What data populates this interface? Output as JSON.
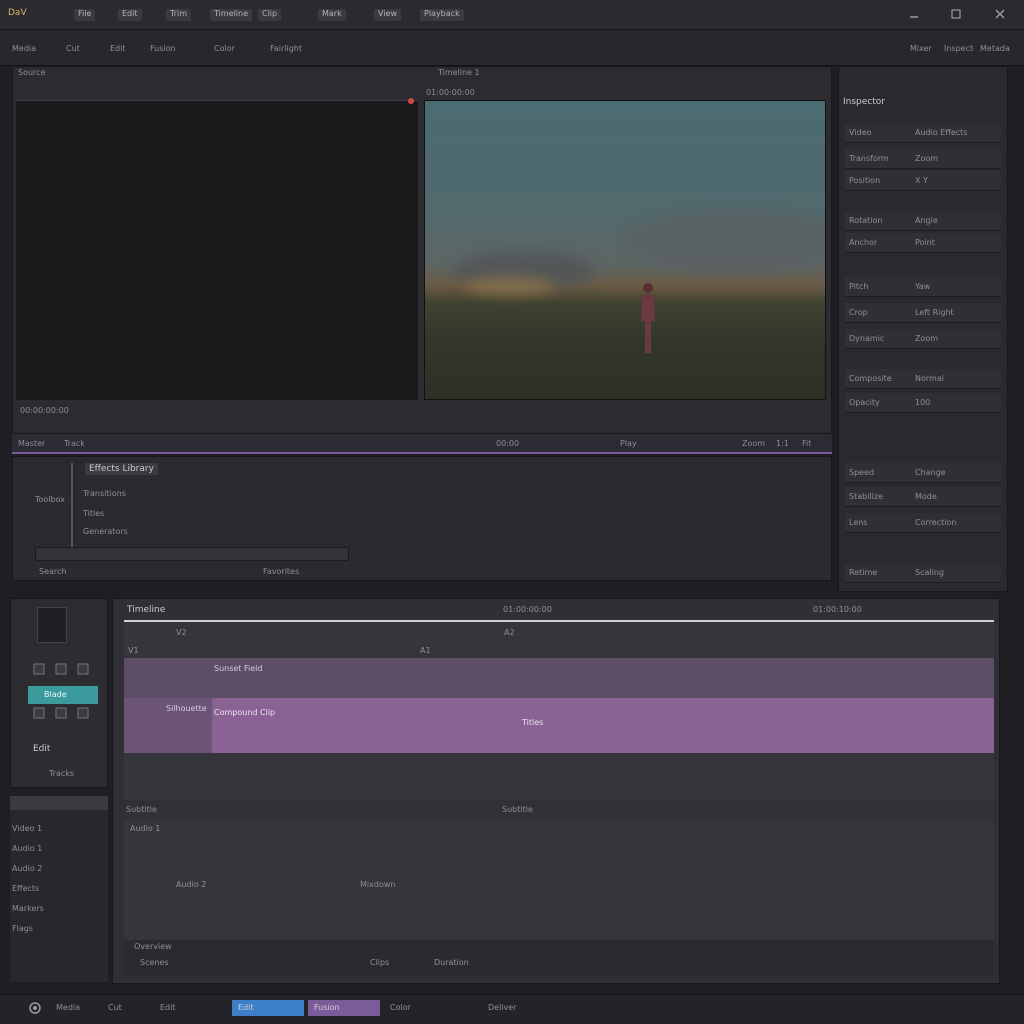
{
  "topbar": {
    "app_label": "DaV",
    "menu": [
      "File",
      "Edit",
      "Trim",
      "Timeline",
      "Clip",
      "Mark",
      "View",
      "Playback"
    ],
    "right_icons": [
      "minimize-icon",
      "maximize-icon",
      "close-icon"
    ]
  },
  "menubar2": {
    "items": [
      "Media",
      "Cut",
      "Edit",
      "Fusion",
      "Color",
      "Fairlight"
    ],
    "right_items": [
      "Mixer",
      "Inspector",
      "Metadata"
    ]
  },
  "source_viewer": {
    "title": "Source",
    "timecode": "00:00:00:00"
  },
  "program_viewer": {
    "title": "Timeline 1",
    "timecode": "01:00:00:00"
  },
  "playbar": {
    "left": [
      "Master",
      "Track"
    ],
    "mid": [
      "00:00",
      "Play"
    ],
    "right": [
      "Zoom",
      "1:1",
      "Fit"
    ]
  },
  "effects": {
    "header": "Effects Library",
    "items": [
      "Toolbox",
      "Transitions",
      "Titles",
      "Generators"
    ],
    "footer": [
      "Search",
      "Favorites"
    ]
  },
  "right_panel": {
    "title": "Inspector",
    "rows": [
      [
        "Video",
        "Audio Effects"
      ],
      [
        "Transform",
        "Zoom"
      ],
      [
        "Position",
        "X Y"
      ],
      [
        "Rotation",
        "Angle"
      ],
      [
        "Anchor",
        "Point"
      ],
      [
        "Pitch",
        "Yaw"
      ],
      [
        "Crop",
        "Left Right"
      ],
      [
        "Dynamic",
        "Zoom"
      ],
      [
        "Composite",
        "Normal"
      ],
      [
        "Opacity",
        "100"
      ],
      [
        "Speed",
        "Change"
      ],
      [
        "Stabilize",
        "Mode"
      ],
      [
        "Lens",
        "Correction"
      ],
      [
        "Retime",
        "Scaling"
      ]
    ]
  },
  "timeline": {
    "header": "Timeline",
    "ruler": [
      "01:00:00:00",
      "01:00:10:00"
    ],
    "track_labels": [
      "V2",
      "V1",
      "A1",
      "A2"
    ],
    "clip_labels": [
      "Sunset Field",
      "Silhouette",
      "Compound Clip",
      "Titles"
    ],
    "lower_labels": [
      "Subtitle",
      "Audio 1",
      "Audio 2",
      "Mixdown"
    ],
    "footer": [
      "Overview",
      "Scenes",
      "Clips",
      "Duration"
    ]
  },
  "tools": {
    "label": "Edit",
    "accent": "Blade",
    "lower_label": "Tracks"
  },
  "left_lower": {
    "items": [
      "Video 1",
      "Audio 1",
      "Audio 2",
      "Effects",
      "Markers",
      "Flags"
    ]
  },
  "bottombar": {
    "tabs": [
      "Media",
      "Cut",
      "Edit",
      "Fusion",
      "Color",
      "Deliver"
    ],
    "active_edit": "Edit",
    "active_color": "Fusion"
  },
  "colors": {
    "purple_clip": "#8a6394",
    "accent_teal": "#3a9a9c",
    "accent_blue": "#3d7fc6",
    "accent_purple": "#7b5c9a"
  }
}
